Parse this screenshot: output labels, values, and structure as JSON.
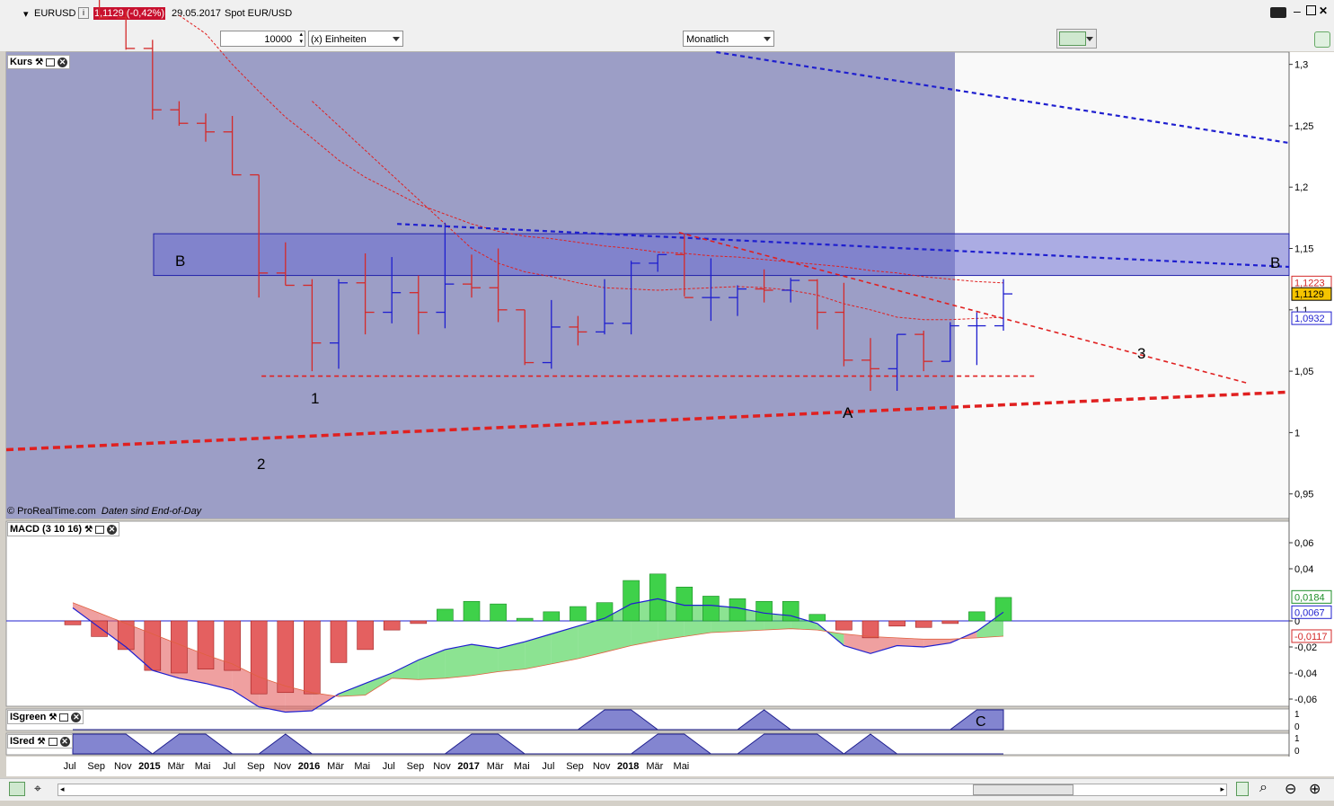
{
  "header": {
    "symbol": "EURUSD",
    "info_icon": "info-icon",
    "price_change": "1,1129 (-0,42%)",
    "date": "29.05.2017",
    "instrument": "Spot EUR/USD"
  },
  "toolbar": {
    "quantity_value": "10000",
    "units_select": "(x) Einheiten",
    "timeframe_select": "Monatlich"
  },
  "colors": {
    "bull": "#1f1fcf",
    "bear": "#d42a2a",
    "shade": "#9c9ec6",
    "zone": "#6b6ed2",
    "macd_pos": "#3fd14a",
    "macd_neg": "#e46060",
    "accent_badge": "#c8102e"
  },
  "chart_data": [
    {
      "type": "ohlc",
      "panel": "Kurs",
      "title": "Kurs",
      "x": [
        "2014-06",
        "2014-07",
        "2014-08",
        "2014-09",
        "2014-10",
        "2014-11",
        "2014-12",
        "2015-01",
        "2015-02",
        "2015-03",
        "2015-04",
        "2015-05",
        "2015-06",
        "2015-07",
        "2015-08",
        "2015-09",
        "2015-10",
        "2015-11",
        "2015-12",
        "2016-01",
        "2016-02",
        "2016-03",
        "2016-04",
        "2016-05",
        "2016-06",
        "2016-07",
        "2016-08",
        "2016-09",
        "2016-10",
        "2016-11",
        "2016-12",
        "2017-01",
        "2017-02",
        "2017-03",
        "2017-04",
        "2017-05"
      ],
      "series": [
        {
          "open": 1.36,
          "high": 1.37,
          "low": 1.355,
          "close": 1.365
        },
        {
          "open": 1.369,
          "high": 1.37,
          "low": 1.337,
          "close": 1.338
        },
        {
          "open": 1.338,
          "high": 1.344,
          "low": 1.312,
          "close": 1.313
        },
        {
          "open": 1.313,
          "high": 1.32,
          "low": 1.255,
          "close": 1.263
        },
        {
          "open": 1.263,
          "high": 1.27,
          "low": 1.25,
          "close": 1.252
        },
        {
          "open": 1.252,
          "high": 1.26,
          "low": 1.237,
          "close": 1.245
        },
        {
          "open": 1.245,
          "high": 1.258,
          "low": 1.21,
          "close": 1.21
        },
        {
          "open": 1.21,
          "high": 1.21,
          "low": 1.11,
          "close": 1.13
        },
        {
          "open": 1.13,
          "high": 1.155,
          "low": 1.12,
          "close": 1.12
        },
        {
          "open": 1.12,
          "high": 1.125,
          "low": 1.05,
          "close": 1.073
        },
        {
          "open": 1.073,
          "high": 1.125,
          "low": 1.052,
          "close": 1.122
        },
        {
          "open": 1.122,
          "high": 1.146,
          "low": 1.08,
          "close": 1.098
        },
        {
          "open": 1.098,
          "high": 1.143,
          "low": 1.089,
          "close": 1.114
        },
        {
          "open": 1.114,
          "high": 1.128,
          "low": 1.08,
          "close": 1.098
        },
        {
          "open": 1.098,
          "high": 1.171,
          "low": 1.085,
          "close": 1.121
        },
        {
          "open": 1.121,
          "high": 1.145,
          "low": 1.11,
          "close": 1.118
        },
        {
          "open": 1.118,
          "high": 1.15,
          "low": 1.09,
          "close": 1.1
        },
        {
          "open": 1.1,
          "high": 1.1,
          "low": 1.055,
          "close": 1.057
        },
        {
          "open": 1.057,
          "high": 1.108,
          "low": 1.052,
          "close": 1.086
        },
        {
          "open": 1.086,
          "high": 1.095,
          "low": 1.071,
          "close": 1.082
        },
        {
          "open": 1.082,
          "high": 1.125,
          "low": 1.08,
          "close": 1.089
        },
        {
          "open": 1.089,
          "high": 1.14,
          "low": 1.08,
          "close": 1.138
        },
        {
          "open": 1.138,
          "high": 1.145,
          "low": 1.131,
          "close": 1.145
        },
        {
          "open": 1.145,
          "high": 1.162,
          "low": 1.111,
          "close": 1.11
        },
        {
          "open": 1.11,
          "high": 1.142,
          "low": 1.091,
          "close": 1.11
        },
        {
          "open": 1.11,
          "high": 1.12,
          "low": 1.095,
          "close": 1.117
        },
        {
          "open": 1.117,
          "high": 1.133,
          "low": 1.106,
          "close": 1.116
        },
        {
          "open": 1.116,
          "high": 1.126,
          "low": 1.106,
          "close": 1.124
        },
        {
          "open": 1.124,
          "high": 1.125,
          "low": 1.084,
          "close": 1.098
        },
        {
          "open": 1.098,
          "high": 1.122,
          "low": 1.054,
          "close": 1.059
        },
        {
          "open": 1.059,
          "high": 1.077,
          "low": 1.034,
          "close": 1.052
        },
        {
          "open": 1.052,
          "high": 1.08,
          "low": 1.034,
          "close": 1.08
        },
        {
          "open": 1.08,
          "high": 1.083,
          "low": 1.05,
          "close": 1.058
        },
        {
          "open": 1.058,
          "high": 1.09,
          "low": 1.058,
          "close": 1.087
        },
        {
          "open": 1.087,
          "high": 1.098,
          "low": 1.055,
          "close": 1.087
        },
        {
          "open": 1.087,
          "high": 1.125,
          "low": 1.083,
          "close": 1.113
        }
      ],
      "ma_slow": [
        1.34,
        1.325,
        1.3,
        1.278,
        1.257,
        1.24,
        1.222,
        1.208,
        1.197,
        1.186,
        1.178,
        1.17,
        1.164,
        1.16,
        1.158,
        1.155,
        1.152,
        1.15,
        1.147,
        1.146,
        1.144,
        1.143,
        1.141,
        1.139,
        1.137,
        1.135,
        1.132,
        1.13,
        1.127,
        1.125,
        1.123,
        1.122
      ],
      "ma_fast": [
        1.27,
        1.25,
        1.23,
        1.21,
        1.19,
        1.17,
        1.15,
        1.138,
        1.131,
        1.127,
        1.122,
        1.118,
        1.117,
        1.116,
        1.117,
        1.118,
        1.119,
        1.118,
        1.116,
        1.112,
        1.105,
        1.1,
        1.094,
        1.092,
        1.092,
        1.093,
        1.094
      ],
      "ylim": [
        0.93,
        1.31
      ],
      "yticks": [
        "1,3",
        "1,25",
        "1,2",
        "1,15",
        "1,1",
        "1,05",
        "1",
        "0,95"
      ],
      "price_labels": [
        {
          "text": "1,1223",
          "value": 1.1223,
          "color": "#d42a2a",
          "bg": "#ffffff"
        },
        {
          "text": "1,1129",
          "value": 1.1129,
          "color": "#000000",
          "bg": "#f5c400"
        },
        {
          "text": "1,0932",
          "value": 1.0932,
          "color": "#1f1fcf",
          "bg": "#ffffff"
        }
      ],
      "zone_B": {
        "top": 1.162,
        "bottom": 1.128
      },
      "annotations": [
        "B",
        "B",
        "1",
        "2",
        "3",
        "A"
      ],
      "watermark": "© ProRealTime.com",
      "watermark_note": "Daten sind End-of-Day"
    },
    {
      "type": "bar",
      "panel": "MACD",
      "title": "MACD (3 10 16)",
      "histogram": [
        -0.003,
        -0.012,
        -0.022,
        -0.038,
        -0.04,
        -0.037,
        -0.038,
        -0.056,
        -0.055,
        -0.056,
        -0.032,
        -0.022,
        -0.007,
        -0.002,
        0.009,
        0.015,
        0.013,
        0.002,
        0.007,
        0.011,
        0.014,
        0.031,
        0.036,
        0.026,
        0.019,
        0.017,
        0.015,
        0.015,
        0.005,
        -0.007,
        -0.013,
        -0.004,
        -0.005,
        -0.002,
        0.007,
        0.018
      ],
      "macd": [
        0.01,
        -0.005,
        -0.02,
        -0.038,
        -0.044,
        -0.048,
        -0.053,
        -0.066,
        -0.07,
        -0.069,
        -0.056,
        -0.048,
        -0.04,
        -0.03,
        -0.022,
        -0.018,
        -0.021,
        -0.016,
        -0.01,
        -0.004,
        0.002,
        0.013,
        0.017,
        0.012,
        0.012,
        0.01,
        0.006,
        0.004,
        -0.002,
        -0.019,
        -0.025,
        -0.019,
        -0.02,
        -0.017,
        -0.008,
        0.0067
      ],
      "signal": [
        0.014,
        0.006,
        -0.002,
        -0.01,
        -0.018,
        -0.026,
        -0.033,
        -0.043,
        -0.05,
        -0.055,
        -0.058,
        -0.057,
        -0.044,
        -0.045,
        -0.044,
        -0.042,
        -0.039,
        -0.037,
        -0.033,
        -0.029,
        -0.024,
        -0.019,
        -0.015,
        -0.012,
        -0.009,
        -0.008,
        -0.007,
        -0.006,
        -0.007,
        -0.01,
        -0.012,
        -0.013,
        -0.014,
        -0.014,
        -0.013,
        -0.0117
      ],
      "ylim": [
        -0.065,
        0.065
      ],
      "yticks": [
        "0,06",
        "0,04",
        "0",
        "-0,02",
        "-0,04",
        "-0,06"
      ],
      "value_labels": [
        {
          "text": "0,0184",
          "value": 0.0184,
          "color": "#1f8f2a"
        },
        {
          "text": "0,0067",
          "value": 0.0067,
          "color": "#1f1fcf"
        },
        {
          "text": "-0,0117",
          "value": -0.0117,
          "color": "#d42a2a"
        }
      ]
    },
    {
      "type": "area",
      "panel": "ISgreen",
      "title": "ISgreen",
      "values": [
        0,
        0,
        0,
        0,
        0,
        0,
        0,
        0,
        0,
        0,
        0,
        0,
        0,
        0,
        0,
        0,
        0,
        0,
        0,
        0,
        1,
        1,
        0,
        0,
        0,
        0,
        1,
        0,
        0,
        0,
        0,
        0,
        0,
        0,
        1,
        1
      ],
      "yticks": [
        "1",
        "0"
      ],
      "annotation": "C"
    },
    {
      "type": "area",
      "panel": "ISred",
      "title": "ISred",
      "values": [
        1,
        1,
        1,
        0,
        1,
        1,
        0,
        0,
        1,
        0,
        0,
        0,
        0,
        0,
        0,
        1,
        1,
        0,
        0,
        0,
        0,
        0,
        1,
        1,
        0,
        0,
        1,
        1,
        1,
        0,
        1,
        0,
        0,
        0,
        0,
        0
      ],
      "yticks": [
        "1",
        "0"
      ]
    }
  ],
  "xaxis_labels": [
    "Jul",
    "Sep",
    "Nov",
    "2015",
    "Mär",
    "Mai",
    "Jul",
    "Sep",
    "Nov",
    "2016",
    "Mär",
    "Mai",
    "Jul",
    "Sep",
    "Nov",
    "2017",
    "Mär",
    "Mai",
    "Jul",
    "Sep",
    "Nov",
    "2018",
    "Mär",
    "Mai"
  ]
}
